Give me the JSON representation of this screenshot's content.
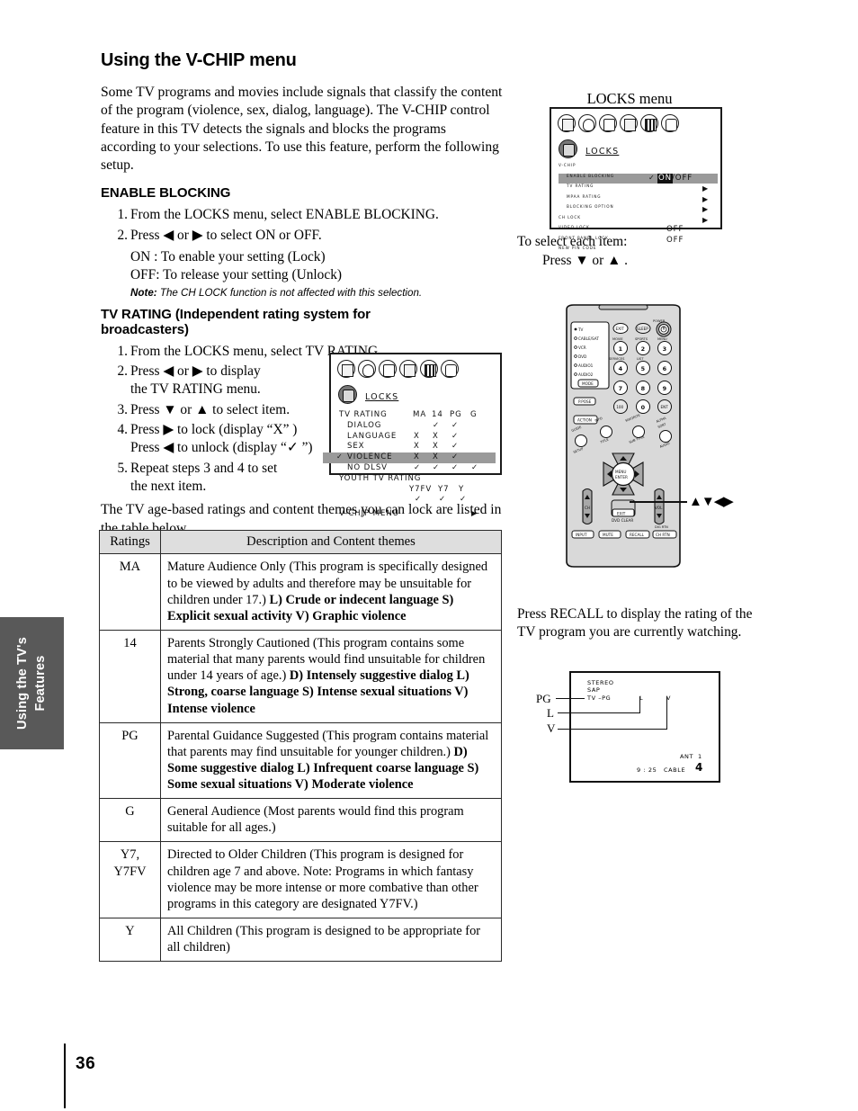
{
  "page": {
    "number": "36",
    "side_tab": "Using the TV's\nFeatures",
    "side_tab_line1": "Using the TV's",
    "side_tab_line2": "Features"
  },
  "main": {
    "title": "Using the V-CHIP menu",
    "intro": "Some TV programs and movies include signals that classify the content of the program (violence, sex, dialog, language). The V-CHIP control feature in this TV detects the signals and blocks the programs according to your selections. To use this feature, perform the following setup.",
    "enable_blocking": {
      "heading": "ENABLE BLOCKING",
      "steps": [
        {
          "num": "1.",
          "text": "From the LOCKS menu, select ENABLE BLOCKING."
        },
        {
          "num": "2.",
          "text": "Press ◀ or ▶ to select ON or OFF."
        }
      ],
      "sub_on": "ON : To enable your setting (Lock)",
      "sub_off": "OFF: To release your setting (Unlock)",
      "note_label": "Note:",
      "note_text": "The CH LOCK function is not affected with this selection."
    },
    "tv_rating": {
      "heading_line1": "TV RATING (Independent rating system for",
      "heading_line2": "broadcasters)",
      "steps": [
        {
          "num": "1.",
          "text": "From the LOCKS menu, select TV RATING."
        },
        {
          "num": "2.",
          "text": "Press ◀ or ▶ to display",
          "text2": "the TV RATING menu."
        },
        {
          "num": "3.",
          "text": "Press ▼ or ▲ to select item."
        },
        {
          "num": "4.",
          "text": "Press ▶ to lock (display “X” )",
          "text2": "Press ◀ to unlock (display “✓ ”)"
        },
        {
          "num": "5.",
          "text": "Repeat steps 3 and 4 to set",
          "text2": "the next item."
        }
      ],
      "after_text": "The TV age-based ratings and content themes you can lock are listed in the table below."
    }
  },
  "table": {
    "headers": [
      "Ratings",
      "Description and Content themes"
    ],
    "rows": [
      {
        "rating": "MA",
        "desc": "Mature Audience Only (This program is specifically designed to be viewed by adults and therefore may be unsuitable for children under 17.)",
        "bold": "L) Crude or indecent language  S) Explicit sexual activity V) Graphic violence"
      },
      {
        "rating": "14",
        "desc": "Parents Strongly Cautioned (This program contains some material that many parents would find unsuitable for children under 14 years of age.)",
        "bold": "D) Intensely suggestive dialog  L) Strong, coarse language S) Intense sexual situations  V) Intense violence"
      },
      {
        "rating": "PG",
        "desc": "Parental Guidance Suggested (This program contains material that parents may find unsuitable for younger children.)",
        "bold": "D) Some suggestive dialog  L) Infrequent coarse language  S) Some sexual situations  V) Moderate violence"
      },
      {
        "rating": "G",
        "desc": "General Audience (Most parents would find this program suitable for all ages.)",
        "bold": ""
      },
      {
        "rating": "Y7,\nY7FV",
        "rating_l1": "Y7,",
        "rating_l2": "Y7FV",
        "desc": "Directed to Older Children (This program is designed for children age 7 and above. Note: Programs in which fantasy violence may be more intense or more combative than other programs in this category are designated Y7FV.)",
        "bold": ""
      },
      {
        "rating": "Y",
        "desc": "All Children (This program is designed to be appropriate for all children)",
        "bold": ""
      }
    ]
  },
  "locks_menu": {
    "caption": "LOCKS menu",
    "selected_icon_label": "LOCKS",
    "group_title": "V-CHIP",
    "items": [
      {
        "label": "ENABLE BLOCKING",
        "value": "ON",
        "value2": "/OFF",
        "type": "onoff",
        "highlighted": true
      },
      {
        "label": "TV RATING",
        "value": "",
        "type": "arrow"
      },
      {
        "label": "MPAA RATING",
        "value": "",
        "type": "arrow"
      },
      {
        "label": "BLOCKING OPTION",
        "value": "",
        "type": "arrow"
      },
      {
        "label": "CH LOCK",
        "value": "",
        "type": "arrow",
        "outdent": true
      },
      {
        "label": "VIDEO LOCK",
        "value": "OFF",
        "type": "value",
        "outdent": true
      },
      {
        "label": "FRONT PANEL LOCK",
        "value": "OFF",
        "type": "value",
        "outdent": true
      },
      {
        "label": "NEW PIN CODE",
        "value": "",
        "type": "plain",
        "outdent": true
      }
    ],
    "select_note_line1": "To select each item:",
    "select_note_line2": "Press ▼ or ▲ ."
  },
  "tv_rating_menu": {
    "selected_icon_label": "LOCKS",
    "column_headers": [
      "MA",
      "14",
      "PG",
      "G"
    ],
    "header_label": "TV RATING",
    "rows": [
      {
        "label": "DIALOG",
        "cells": [
          "",
          "✓",
          "✓",
          ""
        ]
      },
      {
        "label": "LANGUAGE",
        "cells": [
          "X",
          "X",
          "✓",
          ""
        ]
      },
      {
        "label": "SEX",
        "cells": [
          "X",
          "X",
          "✓",
          ""
        ]
      },
      {
        "label": "VIOLENCE",
        "cells": [
          "X",
          "X",
          "✓",
          ""
        ],
        "highlighted": true
      },
      {
        "label": "NO DLSV",
        "cells": [
          "✓",
          "✓",
          "✓",
          "✓"
        ]
      }
    ],
    "youth_label": "YOUTH TV RATING",
    "youth_headers": [
      "Y7FV",
      "Y7",
      "Y"
    ],
    "youth_cells": [
      "✓",
      "✓",
      "✓"
    ],
    "footer": "V-CHIP MENU"
  },
  "remote": {
    "mode_labels": [
      "TV",
      "CABLE/SAT",
      "VCR",
      "DVD",
      "AUDIO1",
      "AUDIO2"
    ],
    "mode_button": "MODE",
    "buttons": {
      "exit_small": "EXIT",
      "sleep": "SLEEP",
      "power": "POWER",
      "movie": "MOVIE",
      "sports": "SPORTS",
      "menu": "MENU",
      "services": "SERVICES",
      "list": "LIST",
      "num1": "1",
      "num2": "2",
      "num3": "3",
      "num4": "4",
      "num5": "5",
      "num6": "6",
      "num7": "7",
      "num8": "8",
      "num9": "9",
      "hundred": "100",
      "num0": "0",
      "ent": "ENT",
      "pip": "PIP",
      "action": "ACTION",
      "info": "INFO",
      "title": "TITLE",
      "favorite": "FAVORITE",
      "sub_title": "SUB TITLE",
      "alpha_sort": "ALPHA SORT",
      "audio": "AUDIO",
      "guide": "GUIDE",
      "setup": "SETUP",
      "menu_enter": "MENU\nENTER",
      "menu_enter_l1": "MENU",
      "menu_enter_l2": "ENTER",
      "ch": "CH",
      "vol": "VOL",
      "exit": "EXIT",
      "dvd_clear": "DVD CLEAR",
      "input": "INPUT",
      "mute": "MUTE",
      "recall": "RECALL",
      "dig_rtn": "DIG RTN",
      "ch_rtn": "CH RTN"
    },
    "callout_arrows": "▲▼◀▶"
  },
  "recall_section": {
    "text": "Press RECALL to display the rating of the TV program you are currently watching.",
    "screen": {
      "stereo": "STEREO",
      "sap": "SAP",
      "rating": "TV –PG",
      "content_l": "L",
      "content_v": "V",
      "ant": "ANT",
      "ant_num": "1",
      "time": "9 : 25",
      "source": "CABLE",
      "channel": "4",
      "callouts": [
        "PG",
        "L",
        "V"
      ]
    }
  },
  "colors": {
    "side_tab_bg": "#595959",
    "table_header_bg": "#dedede",
    "osd_highlight": "#9a9a9a",
    "ink": "#111111"
  }
}
